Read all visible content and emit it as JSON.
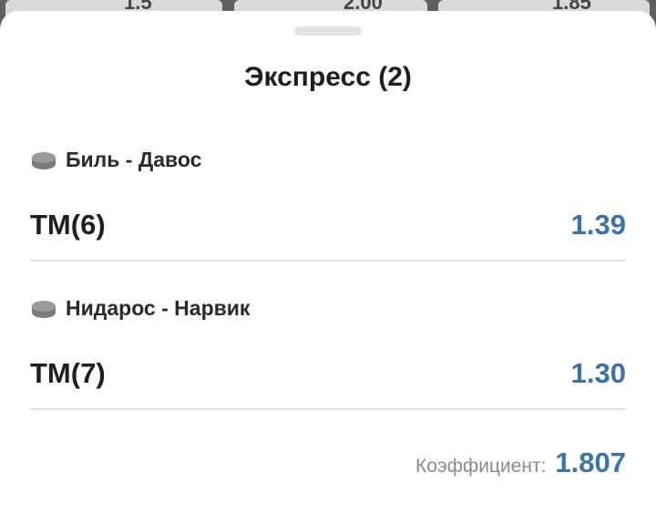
{
  "background": {
    "cells": [
      {
        "text": "1.5"
      },
      {
        "text": "2.00"
      },
      {
        "text": "1.85"
      }
    ]
  },
  "sheet": {
    "title": "Экспресс (2)",
    "icon": "hockey-puck-icon",
    "selections": [
      {
        "event": "Биль - Давос",
        "bet": "ТМ(6)",
        "odd": "1.39"
      },
      {
        "event": "Нидарос - Нарвик",
        "bet": "ТМ(7)",
        "odd": "1.30"
      }
    ],
    "coefficient_label": "Коэффициент:",
    "coefficient_value": "1.807"
  },
  "colors": {
    "accent": "#3d73a1",
    "text": "#1f1f1f",
    "muted": "#8a8a8a",
    "divider": "#e2e2e2"
  }
}
